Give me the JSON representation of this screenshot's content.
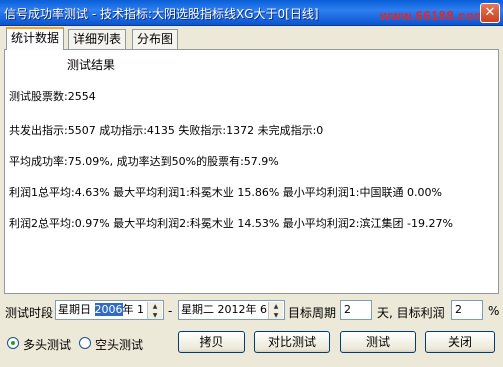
{
  "window": {
    "title": "信号成功率测试 - 技术指标:大阴选股指标线XG大于0[日线]",
    "watermark": "www.66188.com",
    "close_glyph": "✕"
  },
  "tabs": [
    {
      "label": "统计数据",
      "active": true
    },
    {
      "label": "详细列表",
      "active": false
    },
    {
      "label": "分布图",
      "active": false
    }
  ],
  "results": {
    "heading": "测试结果",
    "stock_count": "测试股票数:2554",
    "signals": "共发出指示:5507 成功指示:4135 失败指示:1372 未完成指示:0",
    "success_rate": "平均成功率:75.09%, 成功率达到50%的股票有:57.9%",
    "profit1": "利润1总平均:4.63% 最大平均利润1:科冕木业 15.86% 最小平均利润1:中国联通 0.00%",
    "profit2": "利润2总平均:0.97% 最大平均利润2:科冕木业 14.53% 最小平均利润2:滨江集团 -19.27%"
  },
  "controls": {
    "period_label": "测试时段",
    "start_weekday": "星期日",
    "start_year": "2006",
    "start_rest": "年 1",
    "dash": "-",
    "end_text": "星期二  2012年 6",
    "target_period_label": "目标周期",
    "target_period_value": "2",
    "target_profit_label": "天, 目标利润",
    "target_profit_value": "2",
    "percent": "%",
    "radio_long": "多头测试",
    "radio_short": "空头测试",
    "radio_long_selected": true,
    "btn_copy": "拷贝",
    "btn_compare": "对比测试",
    "btn_test": "测试",
    "btn_close": "关闭"
  }
}
